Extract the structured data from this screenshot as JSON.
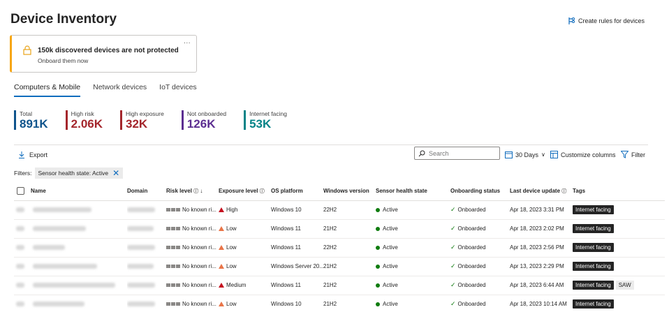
{
  "page": {
    "title": "Device Inventory",
    "create_rules_label": "Create rules for devices"
  },
  "banner": {
    "headline": "150k discovered devices are not protected",
    "sub": "Onboard them now",
    "more": "..."
  },
  "tabs": [
    {
      "label": "Computers & Mobile",
      "active": true
    },
    {
      "label": "Network devices",
      "active": false
    },
    {
      "label": "IoT devices",
      "active": false
    }
  ],
  "stats": [
    {
      "label": "Total",
      "value": "891K",
      "color": "#0f548c"
    },
    {
      "label": "High risk",
      "value": "2.06K",
      "color": "#a4262c"
    },
    {
      "label": "High exposure",
      "value": "32K",
      "color": "#a4262c"
    },
    {
      "label": "Not onboarded",
      "value": "126K",
      "color": "#5c2e91"
    },
    {
      "label": "Internet facing",
      "value": "53K",
      "color": "#038387"
    }
  ],
  "toolbar": {
    "export_label": "Export",
    "search_placeholder": "Search",
    "days_label": "30 Days",
    "customize_label": "Customize columns",
    "filter_label": "Filter"
  },
  "filters": {
    "label": "Filters:",
    "chip": "Sensor health state: Active"
  },
  "columns": {
    "name": "Name",
    "domain": "Domain",
    "risk": "Risk level",
    "exposure": "Exposure level",
    "os": "OS platform",
    "win": "Windows version",
    "sensor": "Sensor health state",
    "onboarding": "Onboarding status",
    "last_update": "Last device update",
    "tags": "Tags"
  },
  "colors": {
    "high": "#c50f1f",
    "medium": "#c50f1f",
    "low": "#e97548",
    "active": "#107c10",
    "accent": "#0f6cbd"
  },
  "rows": [
    {
      "risk": "No known ri...",
      "exposure": "High",
      "exposure_level": "high",
      "os": "Windows 10",
      "win": "22H2",
      "sensor": "Active",
      "onboarding": "Onboarded",
      "last_update": "Apr 18, 2023 3:31 PM",
      "tag": "Internet facing",
      "tag2": ""
    },
    {
      "risk": "No known ri...",
      "exposure": "Low",
      "exposure_level": "low",
      "os": "Windows 11",
      "win": "21H2",
      "sensor": "Active",
      "onboarding": "Onboarded",
      "last_update": "Apr 18, 2023 2:02 PM",
      "tag": "Internet facing",
      "tag2": ""
    },
    {
      "risk": "No known ri...",
      "exposure": "Low",
      "exposure_level": "low",
      "os": "Windows 11",
      "win": "22H2",
      "sensor": "Active",
      "onboarding": "Onboarded",
      "last_update": "Apr 18, 2023 2:56 PM",
      "tag": "Internet facing",
      "tag2": ""
    },
    {
      "risk": "No known ri...",
      "exposure": "Low",
      "exposure_level": "low",
      "os": "Windows Server 20...",
      "win": "21H2",
      "sensor": "Active",
      "onboarding": "Onboarded",
      "last_update": "Apr 13, 2023 2:29 PM",
      "tag": "Internet facing",
      "tag2": ""
    },
    {
      "risk": "No known ri...",
      "exposure": "Medium",
      "exposure_level": "medium",
      "os": "Windows 11",
      "win": "21H2",
      "sensor": "Active",
      "onboarding": "Onboarded",
      "last_update": "Apr 18, 2023 6:44 AM",
      "tag": "Internet facing",
      "tag2": "SAW"
    },
    {
      "risk": "No known ri...",
      "exposure": "Low",
      "exposure_level": "low",
      "os": "Windows 10",
      "win": "21H2",
      "sensor": "Active",
      "onboarding": "Onboarded",
      "last_update": "Apr 18, 2023 10:14 AM",
      "tag": "Internet facing",
      "tag2": ""
    }
  ]
}
